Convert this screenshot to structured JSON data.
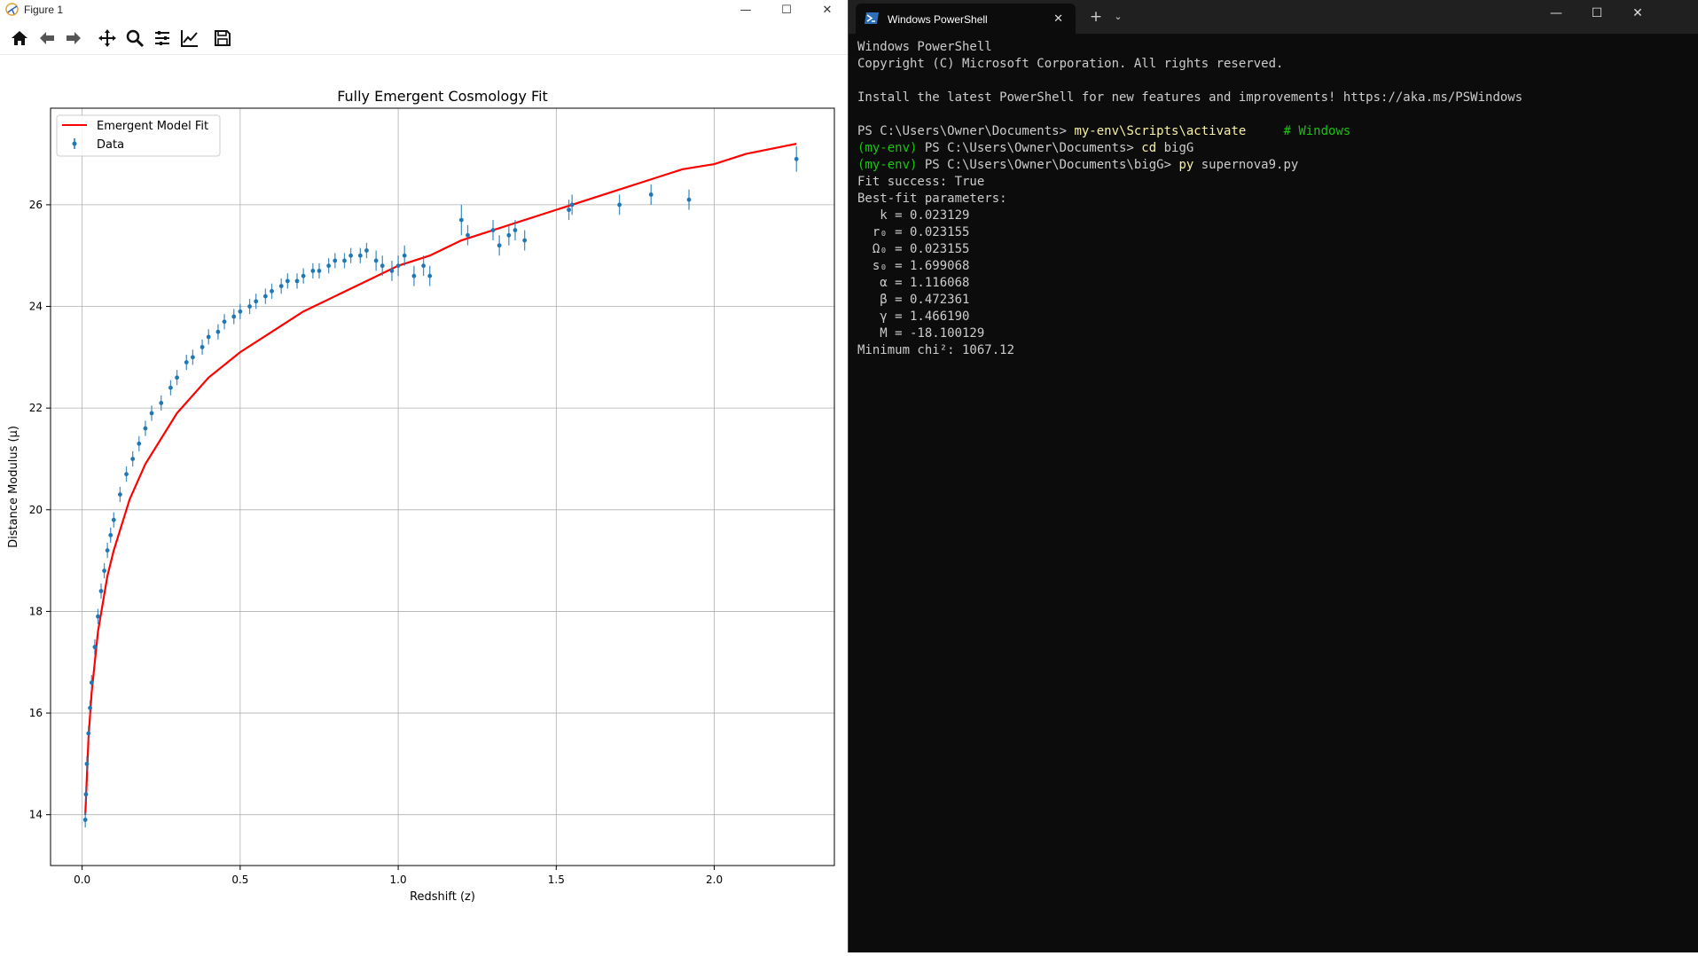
{
  "figure_window": {
    "title": "Figure 1",
    "controls": {
      "minimize": "—",
      "maximize": "☐",
      "close": "✕"
    },
    "toolbar": [
      {
        "name": "home-icon",
        "label": "Home"
      },
      {
        "name": "back-icon",
        "label": "Back"
      },
      {
        "name": "forward-icon",
        "label": "Forward"
      },
      {
        "name": "pan-icon",
        "label": "Pan"
      },
      {
        "name": "zoom-icon",
        "label": "Zoom"
      },
      {
        "name": "configure-subplots-icon",
        "label": "Configure subplots"
      },
      {
        "name": "edit-axis-icon",
        "label": "Edit axis"
      },
      {
        "name": "save-icon",
        "label": "Save"
      }
    ]
  },
  "chart_data": {
    "type": "scatter",
    "title": "Fully Emergent Cosmology Fit",
    "xlabel": "Redshift (z)",
    "ylabel": "Distance Modulus (μ)",
    "xlim": [
      -0.1,
      2.38
    ],
    "ylim": [
      13.0,
      27.9
    ],
    "xticks": [
      0.0,
      0.5,
      1.0,
      1.5,
      2.0
    ],
    "xtick_labels": [
      "0.0",
      "0.5",
      "1.0",
      "1.5",
      "2.0"
    ],
    "yticks": [
      14,
      16,
      18,
      20,
      22,
      24,
      26
    ],
    "ytick_labels": [
      "14",
      "16",
      "18",
      "20",
      "22",
      "24",
      "26"
    ],
    "grid": true,
    "legend_position": "top-left",
    "colors": {
      "model": "#ff0000",
      "data": "#1f77b4"
    },
    "series": [
      {
        "name": "Emergent Model Fit",
        "kind": "line",
        "x": [
          0.01,
          0.02,
          0.03,
          0.05,
          0.08,
          0.1,
          0.15,
          0.2,
          0.3,
          0.4,
          0.5,
          0.6,
          0.7,
          0.8,
          0.9,
          1.0,
          1.1,
          1.2,
          1.3,
          1.4,
          1.5,
          1.6,
          1.7,
          1.8,
          1.9,
          2.0,
          2.1,
          2.26
        ],
        "y": [
          14.0,
          15.5,
          16.4,
          17.6,
          18.7,
          19.2,
          20.2,
          20.9,
          21.9,
          22.6,
          23.1,
          23.5,
          23.9,
          24.2,
          24.5,
          24.8,
          25.0,
          25.3,
          25.5,
          25.7,
          25.9,
          26.1,
          26.3,
          26.5,
          26.7,
          26.8,
          27.0,
          27.2
        ]
      },
      {
        "name": "Data",
        "kind": "errorbar",
        "x": [
          0.01,
          0.012,
          0.015,
          0.02,
          0.025,
          0.03,
          0.04,
          0.05,
          0.06,
          0.07,
          0.08,
          0.09,
          0.1,
          0.12,
          0.14,
          0.16,
          0.18,
          0.2,
          0.22,
          0.25,
          0.28,
          0.3,
          0.33,
          0.35,
          0.38,
          0.4,
          0.43,
          0.45,
          0.48,
          0.5,
          0.53,
          0.55,
          0.58,
          0.6,
          0.63,
          0.65,
          0.68,
          0.7,
          0.73,
          0.75,
          0.78,
          0.8,
          0.83,
          0.85,
          0.88,
          0.9,
          0.93,
          0.95,
          0.98,
          1.0,
          1.02,
          1.05,
          1.08,
          1.1,
          1.2,
          1.22,
          1.3,
          1.32,
          1.35,
          1.37,
          1.4,
          1.54,
          1.55,
          1.7,
          1.8,
          1.92,
          2.26
        ],
        "y": [
          13.9,
          14.4,
          15.0,
          15.6,
          16.1,
          16.6,
          17.3,
          17.9,
          18.4,
          18.8,
          19.2,
          19.5,
          19.8,
          20.3,
          20.7,
          21.0,
          21.3,
          21.6,
          21.9,
          22.1,
          22.4,
          22.6,
          22.9,
          23.0,
          23.2,
          23.4,
          23.5,
          23.7,
          23.8,
          23.9,
          24.0,
          24.1,
          24.2,
          24.3,
          24.4,
          24.5,
          24.5,
          24.6,
          24.7,
          24.7,
          24.8,
          24.9,
          24.9,
          25.0,
          25.0,
          25.1,
          24.9,
          24.8,
          24.7,
          24.8,
          25.0,
          24.6,
          24.8,
          24.6,
          25.7,
          25.4,
          25.5,
          25.2,
          25.4,
          25.5,
          25.3,
          25.9,
          26.0,
          26.0,
          26.2,
          26.1,
          26.9
        ],
        "err": [
          0.15,
          0.15,
          0.15,
          0.15,
          0.15,
          0.15,
          0.15,
          0.15,
          0.15,
          0.15,
          0.15,
          0.15,
          0.15,
          0.15,
          0.15,
          0.15,
          0.15,
          0.15,
          0.15,
          0.15,
          0.15,
          0.15,
          0.15,
          0.15,
          0.15,
          0.15,
          0.15,
          0.15,
          0.15,
          0.15,
          0.15,
          0.15,
          0.15,
          0.15,
          0.15,
          0.15,
          0.15,
          0.15,
          0.15,
          0.15,
          0.15,
          0.15,
          0.15,
          0.15,
          0.15,
          0.15,
          0.2,
          0.2,
          0.2,
          0.2,
          0.2,
          0.2,
          0.2,
          0.2,
          0.3,
          0.2,
          0.2,
          0.2,
          0.2,
          0.2,
          0.2,
          0.2,
          0.2,
          0.2,
          0.2,
          0.2,
          0.25
        ]
      }
    ]
  },
  "terminal": {
    "tab_title": "Windows PowerShell",
    "tab_close": "✕",
    "new_tab": "+",
    "dropdown": "⌄",
    "controls": {
      "minimize": "—",
      "maximize": "☐",
      "close": "✕"
    },
    "lines": [
      [
        {
          "t": "Windows PowerShell",
          "c": "white"
        }
      ],
      [
        {
          "t": "Copyright (C) Microsoft Corporation. All rights reserved.",
          "c": "white"
        }
      ],
      [
        {
          "t": "",
          "c": "white"
        }
      ],
      [
        {
          "t": "Install the latest PowerShell for new features and improvements! https://aka.ms/PSWindows",
          "c": "white"
        }
      ],
      [
        {
          "t": "",
          "c": "white"
        }
      ],
      [
        {
          "t": "PS C:\\Users\\Owner\\Documents> ",
          "c": "white"
        },
        {
          "t": "my-env\\Scripts\\activate",
          "c": "yellow"
        },
        {
          "t": "     # Windows",
          "c": "green"
        }
      ],
      [
        {
          "t": "(my-env) ",
          "c": "green"
        },
        {
          "t": "PS C:\\Users\\Owner\\Documents> ",
          "c": "white"
        },
        {
          "t": "cd",
          "c": "yellow"
        },
        {
          "t": " bigG",
          "c": "white"
        }
      ],
      [
        {
          "t": "(my-env) ",
          "c": "green"
        },
        {
          "t": "PS C:\\Users\\Owner\\Documents\\bigG> ",
          "c": "white"
        },
        {
          "t": "py",
          "c": "yellow"
        },
        {
          "t": " supernova9.py",
          "c": "white"
        }
      ],
      [
        {
          "t": "Fit success: True",
          "c": "white"
        }
      ],
      [
        {
          "t": "Best-fit parameters:",
          "c": "white"
        }
      ],
      [
        {
          "t": "   k = 0.023129",
          "c": "white"
        }
      ],
      [
        {
          "t": "  r₀ = 0.023155",
          "c": "white"
        }
      ],
      [
        {
          "t": "  Ω₀ = 0.023155",
          "c": "white"
        }
      ],
      [
        {
          "t": "  s₀ = 1.699068",
          "c": "white"
        }
      ],
      [
        {
          "t": "   α = 1.116068",
          "c": "white"
        }
      ],
      [
        {
          "t": "   β = 0.472361",
          "c": "white"
        }
      ],
      [
        {
          "t": "   γ = 1.466190",
          "c": "white"
        }
      ],
      [
        {
          "t": "   M = -18.100129",
          "c": "white"
        }
      ],
      [
        {
          "t": "Minimum chi²: 1067.12",
          "c": "white"
        }
      ]
    ]
  }
}
